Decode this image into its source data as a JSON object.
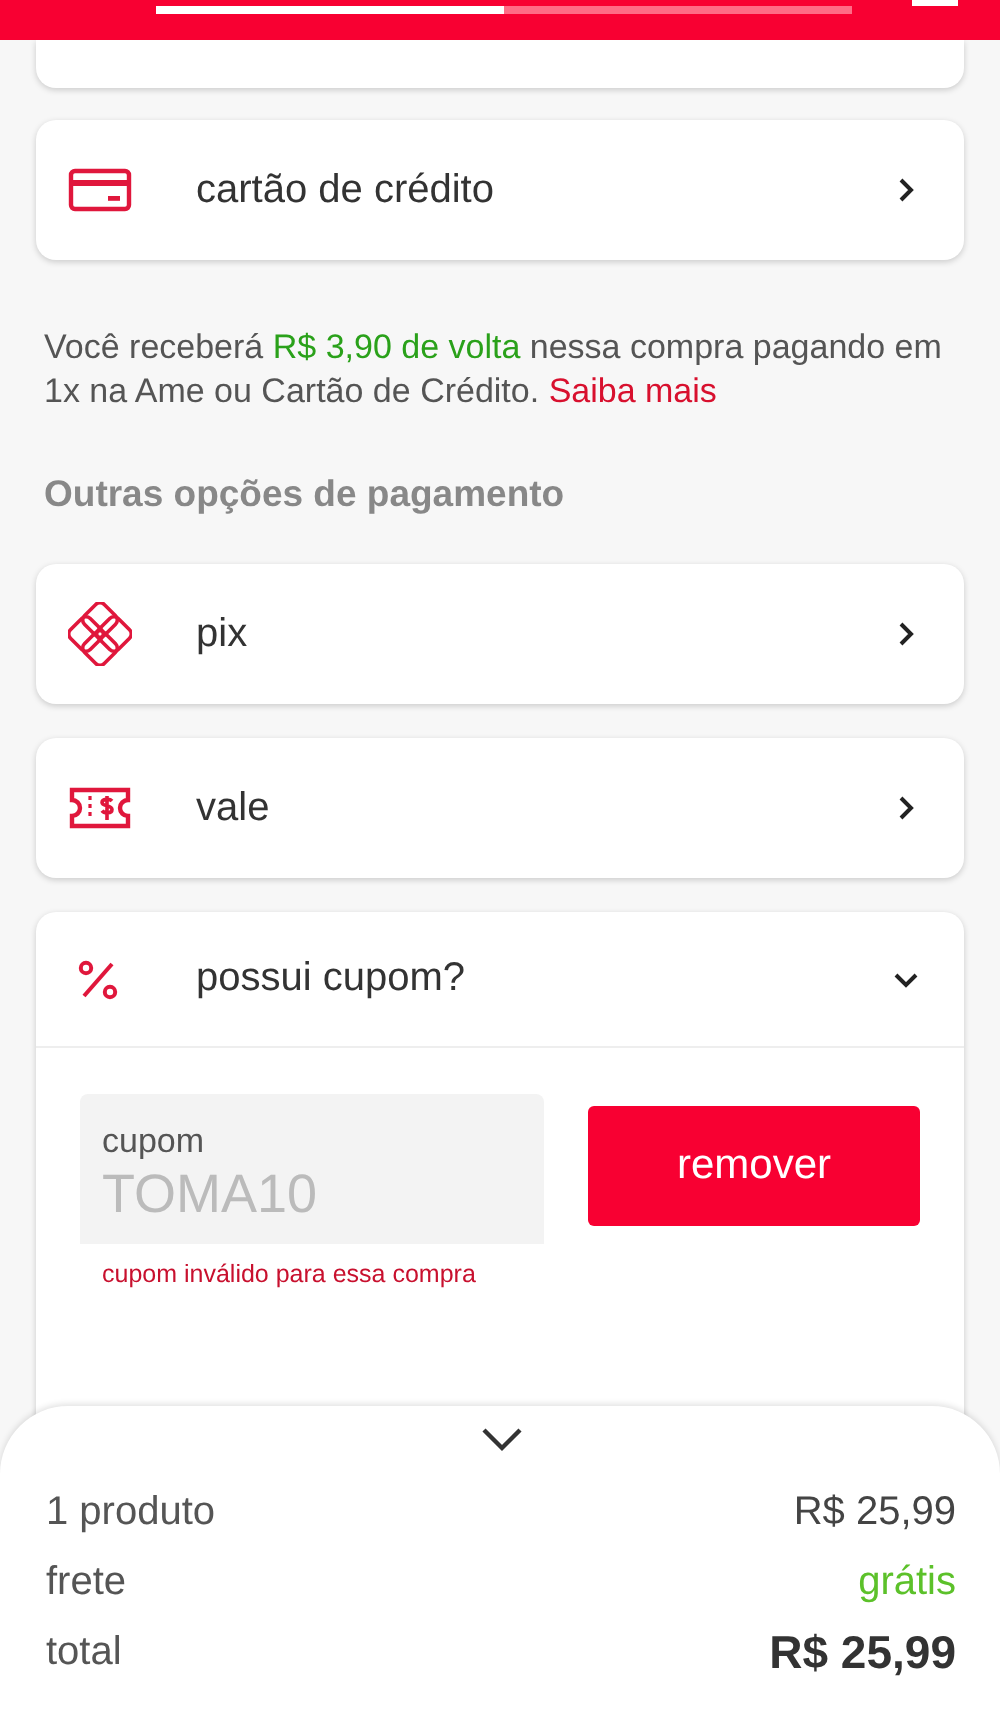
{
  "header": {
    "progress": {
      "level": 0.5
    }
  },
  "payment_methods": [
    {
      "kind": "card",
      "label": "cartão de crédito"
    }
  ],
  "cashback_note": {
    "before": "Você receberá ",
    "highlight": "R$ 3,90 de volta",
    "after": " nessa compra pagando em 1x na Ame ou Cartão de Crédito. ",
    "link": "Saiba mais"
  },
  "other_heading": "Outras opções de pagamento",
  "other_methods": [
    {
      "kind": "pix",
      "label": "pix"
    },
    {
      "kind": "voucher",
      "label": "vale"
    }
  ],
  "coupon": {
    "label": "possui cupom?",
    "expanded": true,
    "field_label": "cupom",
    "value": "TOMA10",
    "error": "cupom inválido para essa compra",
    "button": "remover"
  },
  "summary": {
    "rows": [
      {
        "kind": "normal",
        "label": "1 produto",
        "value": "R$ 25,99"
      },
      {
        "kind": "free",
        "label": "frete",
        "value": "grátis"
      },
      {
        "kind": "total",
        "label": "total",
        "value": "R$ 25,99"
      }
    ]
  }
}
